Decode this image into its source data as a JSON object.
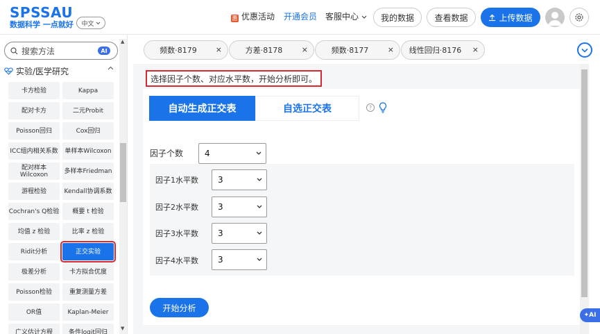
{
  "brand": {
    "name": "SPSSAU",
    "slogan": "数据科学 一点就好",
    "lang": "中文"
  },
  "nav": {
    "promo": "优惠活动",
    "vip": "开通会员",
    "service": "客服中心",
    "my_data": "我的数据",
    "view_data": "查看数据",
    "upload": "上传数据"
  },
  "sidebar": {
    "search_placeholder": "搜索方法",
    "ai_badge": "AI",
    "section": "实验/医学研究",
    "methods": [
      [
        "卡方检验",
        "Kappa"
      ],
      [
        "配对卡方",
        "二元Probit"
      ],
      [
        "Poisson回归",
        "Cox回归"
      ],
      [
        "ICC组内相关系数",
        "单样本Wilcoxon"
      ],
      [
        "配对样本Wilcoxon",
        "多样本Friedman"
      ],
      [
        "游程检验",
        "Kendall协调系数"
      ],
      [
        "Cochran's Q检验",
        "概要 t 检验"
      ],
      [
        "均值 z 检验",
        "比率 z 检验"
      ],
      [
        "Ridit分析",
        "正交实验"
      ],
      [
        "极差分析",
        "卡方拟合优度"
      ],
      [
        "Poisson检验",
        "重复测量方差"
      ],
      [
        "OR值",
        "Kaplan-Meier"
      ],
      [
        "广义估计方程",
        "条件logit回归"
      ]
    ],
    "active_method": "正交实验"
  },
  "tabs": [
    {
      "label": "频数·8179",
      "close": "×"
    },
    {
      "label": "方差·8178",
      "close": "×"
    },
    {
      "label": "频数·8177",
      "close": "×"
    },
    {
      "label": "线性回归·8176",
      "close": "×"
    }
  ],
  "main": {
    "hint": "选择因子个数、对应水平数，开始分析即可。",
    "mode_auto": "自动生成正交表",
    "mode_custom": "自选正交表",
    "help": "?",
    "factor_count_label": "因子个数",
    "factor_count_value": "4",
    "levels": [
      {
        "label": "因子1水平数",
        "value": "3"
      },
      {
        "label": "因子2水平数",
        "value": "3"
      },
      {
        "label": "因子3水平数",
        "value": "3"
      },
      {
        "label": "因子4水平数",
        "value": "3"
      }
    ],
    "start": "开始分析",
    "ai_float": "AI"
  },
  "colors": {
    "primary": "#1a73e8",
    "highlight": "#d9282f",
    "promo": "#e8562f"
  }
}
